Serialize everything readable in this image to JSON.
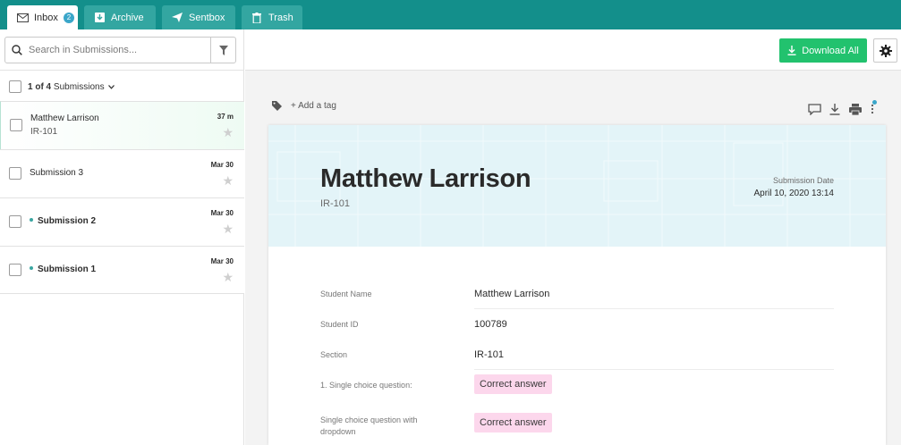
{
  "tabs": [
    {
      "label": "Inbox",
      "icon": "envelope-icon",
      "badge": "2",
      "active": true
    },
    {
      "label": "Archive",
      "icon": "archive-icon"
    },
    {
      "label": "Sentbox",
      "icon": "paper-plane-icon"
    },
    {
      "label": "Trash",
      "icon": "trash-icon"
    }
  ],
  "search": {
    "placeholder": "Search in Submissions...",
    "value": ""
  },
  "selection": {
    "count_prefix": "1 of 4",
    "count_suffix": "Submissions"
  },
  "submissions": [
    {
      "name": "Matthew Larrison",
      "section": "IR-101",
      "time": "37 m",
      "selected": true,
      "unread": false
    },
    {
      "name": "Submission 3",
      "section": "",
      "time": "Mar 30",
      "selected": false,
      "unread": false
    },
    {
      "name": "Submission 2",
      "section": "",
      "time": "Mar 30",
      "selected": false,
      "unread": true
    },
    {
      "name": "Submission 1",
      "section": "",
      "time": "Mar 30",
      "selected": false,
      "unread": true
    }
  ],
  "toolbar": {
    "download_all_label": "Download All",
    "add_tag_label": "+ Add a tag"
  },
  "document": {
    "name": "Matthew Larrison",
    "section": "IR-101",
    "submission_date_label": "Submission Date",
    "submission_date": "April 10, 2020 13:14",
    "fields": [
      {
        "label": "Student Name",
        "value": "Matthew Larrison"
      },
      {
        "label": "Student ID",
        "value": "100789"
      },
      {
        "label": "Section",
        "value": "IR-101"
      },
      {
        "label": "1. Single choice question:",
        "value": "Correct answer"
      },
      {
        "label": "Single choice question with dropdown",
        "value": "Correct answer"
      }
    ]
  },
  "colors": {
    "accent": "#138f8b",
    "tab_inactive": "#33a6a1",
    "download_button": "#22c26e",
    "answer_pill": "#fcd7ec",
    "header_band": "#e3f4f8"
  }
}
